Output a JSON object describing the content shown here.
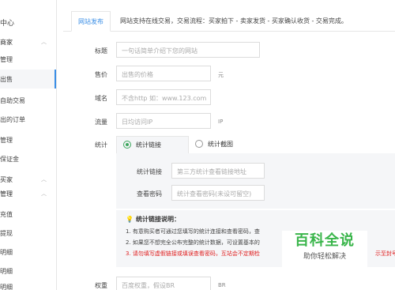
{
  "sidebar": {
    "center_title": "中心",
    "seller_group": "商家",
    "items": [
      "管理",
      "出售",
      "自助交易",
      "出的订单",
      "管理",
      "保证金"
    ],
    "buyer_group": "买家",
    "buyer_manage": "管理",
    "buyer_items": [
      "充值",
      "提现",
      "明细",
      "明细",
      "明细"
    ]
  },
  "tab": {
    "label": "网站发布"
  },
  "notice": "网站支持在线交易，交易流程：买家拍下 - 卖家发货 - 买家确认收货 - 交易完成。",
  "form": {
    "title_label": "标题",
    "title_placeholder": "一句话简单介绍下您的网站",
    "price_label": "售价",
    "price_placeholder": "出售的价格",
    "price_unit": "元",
    "domain_label": "域名",
    "domain_placeholder": "不含http 如：www.123.com",
    "traffic_label": "流量",
    "traffic_placeholder": "日均访问IP",
    "traffic_unit": "IP",
    "stats_label": "统计",
    "weight_label": "权重",
    "weight_placeholder": "百度权重，假设BR",
    "weight_unit": "BR"
  },
  "stats": {
    "tab_link": "统计链接",
    "tab_screenshot": "统计截图",
    "link_label": "统计链接",
    "link_placeholder": "第三方统计查看链接地址",
    "password_label": "查看密码",
    "password_placeholder": "统计查看密码(未设可留空)"
  },
  "help": {
    "title": "统计链接说明：",
    "line1": "1. 有意购买者可通过您填写的统计连接和查看密码，查",
    "line2": "2. 如果您不想完全公布完整的统计数据，可设置基本的",
    "line3": "3. 请勿填写虚假链接或填误查看密码，互站会不定期检",
    "line3_tail": "示至封号"
  },
  "watermark": {
    "title": "百科全说",
    "subtitle": "助你轻松解决"
  }
}
